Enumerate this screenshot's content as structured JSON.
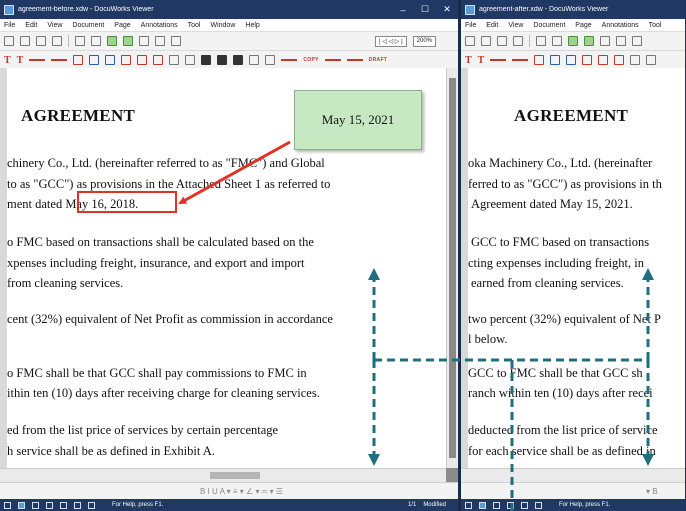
{
  "left_window": {
    "title": "agreement-before.xdw - DocuWorks Viewer",
    "controls": {
      "minimize": "–",
      "maximize": "☐",
      "close": "✕"
    },
    "menu": [
      "File",
      "Edit",
      "View",
      "Document",
      "Page",
      "Annotations",
      "Tool",
      "Window",
      "Help"
    ],
    "toolbar": {
      "page_nav": "| ◁  ◁  ▷  |",
      "zoom": "200%"
    },
    "annotation_bar": {
      "text_tool_1": "T",
      "text_tool_2": "T",
      "stamp_copy": "COPY",
      "stamp_draft": "DRAFT"
    },
    "document": {
      "heading": "AGREEMENT",
      "lines": [
        "chinery Co., Ltd. (hereinafter referred to as \"FMC\") and Global",
        "to as \"GCC\") as provisions in the Attached Sheet 1 as referred to",
        "ment dated May 16, 2018.",
        "o FMC based on transactions shall be calculated based on the",
        "xpenses including freight, insurance, and export and import",
        "from cleaning services.",
        "cent (32%) equivalent of Net Profit as commission in accordance",
        "o FMC shall be that GCC shall pay commissions to FMC in",
        "ithin ten (10) days after receiving charge for cleaning services.",
        "ed from the list price of services by certain percentage",
        "h service shall be as defined in Exhibit A."
      ],
      "sticky_note": "May 15, 2021"
    },
    "format_bar": "B  I  U  A ▾  ≡ ▾  ∠ ▾  ═ ▾  ☰",
    "status": {
      "help": "For Help, press F1.",
      "page": "1/1",
      "state": "Modified"
    }
  },
  "right_window": {
    "title": "agreement-after.xdw - DocuWorks Viewer",
    "menu": [
      "File",
      "Edit",
      "View",
      "Document",
      "Page",
      "Annotations",
      "Tool"
    ],
    "document": {
      "heading": "AGREEMENT",
      "lines": [
        "oka Machinery Co., Ltd. (hereinafter",
        "ferred to as \"GCC\") as provisions in th",
        "Agreement dated May 15, 2021.",
        "GCC to FMC based on transactions",
        "cting expenses including freight, in",
        "earned from cleaning services.",
        "two percent (32%) equivalent of Net P",
        "l below.",
        "GCC to FMC shall be that GCC sh",
        "ranch within ten (10) days after recei",
        "deducted from the list price of service",
        "for each service shall be as defined in"
      ]
    },
    "format_bar": "▾  B",
    "status": {
      "help": "For Help, press F1."
    }
  },
  "colors": {
    "titlebar": "#1f3864",
    "highlight": "#e03222",
    "sticky_note": "#c6e8c2",
    "arrow": "#1e6f7f"
  }
}
